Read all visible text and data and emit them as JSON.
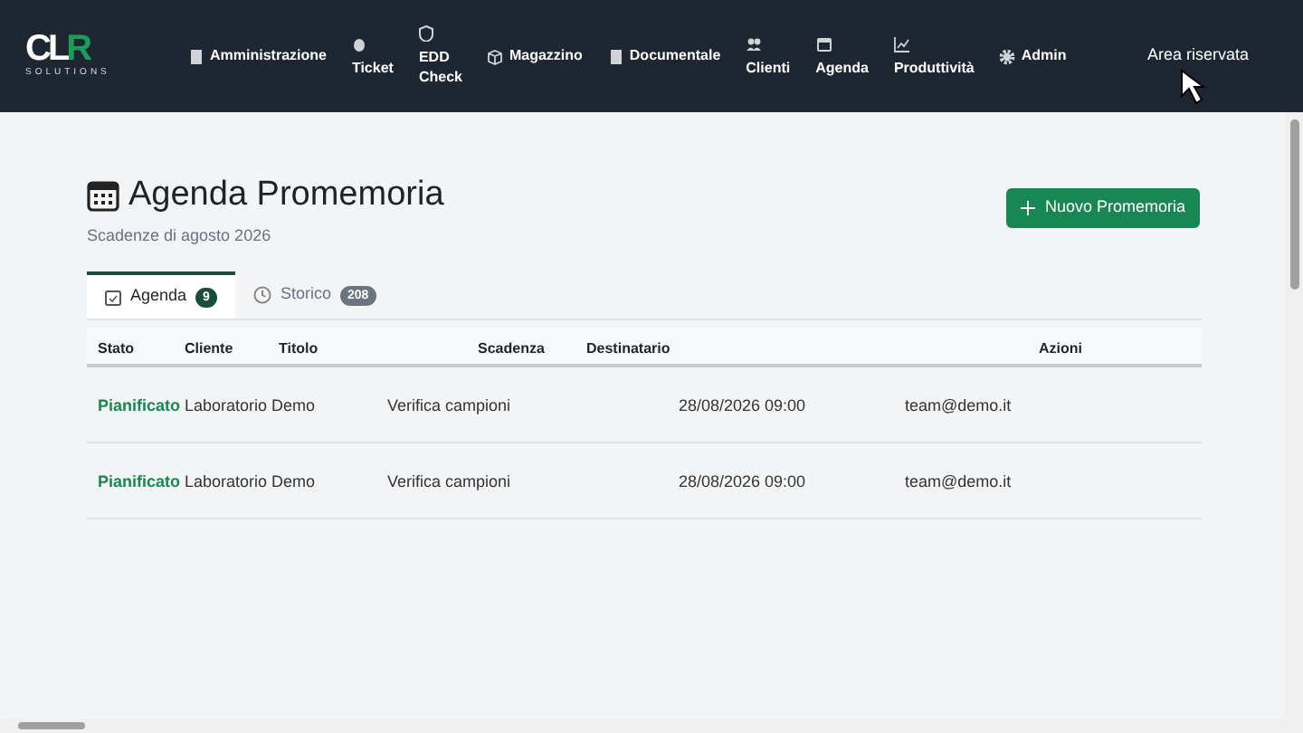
{
  "logo": {
    "mark_left": "CL",
    "mark_right": "R",
    "tagline": "SOLUTIONS"
  },
  "nav": [
    {
      "label": "Amministrazione",
      "kind": "inline"
    },
    {
      "label": "Ticket",
      "kind": "stacked"
    },
    {
      "label": "EDD Check",
      "kind": "stacked"
    },
    {
      "label": "Magazzino",
      "kind": "inline"
    },
    {
      "label": "Documentale",
      "kind": "inline"
    },
    {
      "label": "Clienti",
      "kind": "stacked"
    },
    {
      "label": "Agenda",
      "kind": "stacked"
    },
    {
      "label": "Produttività",
      "kind": "stacked"
    },
    {
      "label": "Admin",
      "kind": "inline"
    }
  ],
  "reserved_link": "Area riservata",
  "page": {
    "title": "Agenda Promemoria",
    "subtitle": "Scadenze di agosto 2026",
    "new_button": "Nuovo Promemoria"
  },
  "tabs": [
    {
      "label": "Agenda",
      "count": "9",
      "selected": true
    },
    {
      "label": "Storico",
      "count": "208",
      "selected": false
    }
  ],
  "table": {
    "columns": [
      "Stato",
      "Cliente",
      "Titolo",
      "Scadenza",
      "Destinatario",
      "Azioni"
    ],
    "rows": [
      {
        "stato": "Pianificato",
        "cliente": "Laboratorio Demo",
        "titolo": "Verifica campioni",
        "scadenza": "28/08/2026 09:00",
        "destinatario": "team@demo.it"
      },
      {
        "stato": "Pianificato",
        "cliente": "Laboratorio Demo",
        "titolo": "Verifica campioni",
        "scadenza": "28/08/2026 09:00",
        "destinatario": "team@demo.it"
      }
    ]
  }
}
